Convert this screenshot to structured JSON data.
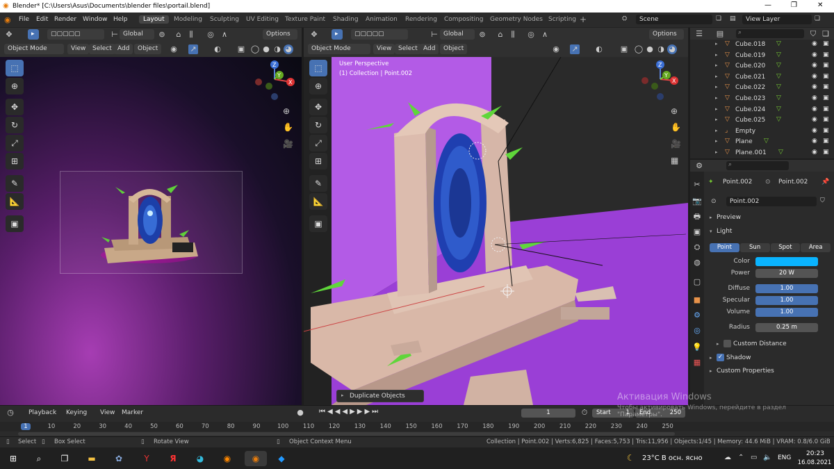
{
  "window": {
    "title": "Blender* [C:\\Users\\Asus\\Documents\\blender files\\portail.blend]"
  },
  "menu": [
    "File",
    "Edit",
    "Render",
    "Window",
    "Help"
  ],
  "workspaces": [
    "Layout",
    "Modeling",
    "Sculpting",
    "UV Editing",
    "Texture Paint",
    "Shading",
    "Animation",
    "Rendering",
    "Compositing",
    "Geometry Nodes",
    "Scripting"
  ],
  "active_workspace": "Layout",
  "scene": {
    "label": "Scene",
    "view_layer": "View Layer"
  },
  "left_view": {
    "transform": "Global",
    "options": "Options",
    "mode": "Object Mode",
    "view": "View",
    "select": "Select",
    "add": "Add",
    "object": "Object"
  },
  "right_view": {
    "transform": "Global",
    "options": "Options",
    "mode": "Object Mode",
    "view": "View",
    "select": "Select",
    "add": "Add",
    "object": "Object",
    "perspective": "User Perspective",
    "collection": "(1) Collection | Point.002",
    "operator_panel": "Duplicate Objects"
  },
  "outliner": {
    "items": [
      {
        "name": "Cube.018"
      },
      {
        "name": "Cube.019"
      },
      {
        "name": "Cube.020"
      },
      {
        "name": "Cube.021"
      },
      {
        "name": "Cube.022"
      },
      {
        "name": "Cube.023"
      },
      {
        "name": "Cube.024"
      },
      {
        "name": "Cube.025"
      },
      {
        "name": "Empty"
      },
      {
        "name": "Plane"
      },
      {
        "name": "Plane.001"
      }
    ]
  },
  "properties": {
    "breadcrumb_object": "Point.002",
    "breadcrumb_data": "Point.002",
    "datablock": "Point.002",
    "preview": "Preview",
    "light_section": "Light",
    "light_types": [
      "Point",
      "Sun",
      "Spot",
      "Area"
    ],
    "active_type": "Point",
    "color_label": "Color",
    "color_value": "#0ab4ff",
    "power_label": "Power",
    "power": "20 W",
    "diffuse_label": "Diffuse",
    "diffuse": "1.00",
    "specular_label": "Specular",
    "specular": "1.00",
    "volume_label": "Volume",
    "volume": "1.00",
    "radius_label": "Radius",
    "radius": "0.25 m",
    "custom_distance": "Custom Distance",
    "shadow": "Shadow",
    "custom_properties": "Custom Properties"
  },
  "timeline": {
    "playback": "Playback",
    "keying": "Keying",
    "view": "View",
    "marker": "Marker",
    "current_frame": "1",
    "start_label": "Start",
    "start": "1",
    "end_label": "End",
    "end": "250",
    "ticks": [
      "1",
      "10",
      "20",
      "30",
      "40",
      "50",
      "60",
      "70",
      "80",
      "90",
      "100",
      "110",
      "120",
      "130",
      "140",
      "150",
      "160",
      "170",
      "180",
      "190",
      "200",
      "210",
      "220",
      "230",
      "240",
      "250"
    ]
  },
  "status": {
    "select": "Select",
    "box_select": "Box Select",
    "rotate_view": "Rotate View",
    "context_menu": "Object Context Menu",
    "stats": "Collection | Point.002 | Verts:6,825 | Faces:5,753 | Tris:11,956 | Objects:1/45 | Memory: 44.6 MiB | VRAM: 0.8/6.0 GiB | 2.93.2"
  },
  "watermark": {
    "title": "Активация Windows",
    "body": "Чтобы активировать Windows, перейдите в раздел \"Параметры\"."
  },
  "taskbar": {
    "weather": "23°C  В осн. ясно",
    "language": "ENG",
    "time": "20:23",
    "date": "16.08.2021"
  }
}
